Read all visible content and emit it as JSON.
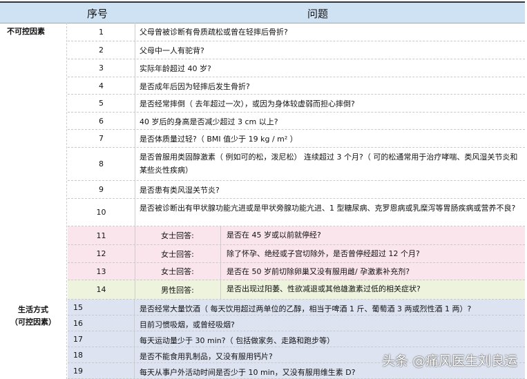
{
  "header": {
    "col_num": "序号",
    "col_q": "问题"
  },
  "categories": {
    "uncontrollable": "不可控因素",
    "lifestyle_1": "生活方式",
    "lifestyle_2": "（可控因素）"
  },
  "rows": [
    {
      "n": "1",
      "q": "父母曾被诊断有骨质疏松或曾在轻摔后骨折?"
    },
    {
      "n": "2",
      "q": "父母中一人有驼背?"
    },
    {
      "n": "3",
      "q": "实际年龄超过 40 岁?"
    },
    {
      "n": "4",
      "q": "是否成年后因为轻摔后发生骨折?"
    },
    {
      "n": "5",
      "q": "是否经常摔倒（ 去年超过一次），或因为身体较虚弱而担心摔倒?"
    },
    {
      "n": "6",
      "q": "40 岁后的身高是否减少超过 3 cm 以上?"
    },
    {
      "n": "7",
      "q": "是否体质量过轻?（ BMI 值少于 19 kg / m² ）"
    },
    {
      "n": "8",
      "q": "是否曾服用类固醇激素（ 例如可的松，泼尼松） 连续超过 3 个月?（ 可的松通常用于治疗哮喘、类风湿关节炎和某些炎性疾病）"
    },
    {
      "n": "9",
      "q": "是否患有类风湿关节炎?"
    },
    {
      "n": "10",
      "q": "是否被诊断出有甲状腺功能亢进或是甲状旁腺功能亢进、1 型糖尿病、克罗恩病或乳糜泻等胃肠疾病或营养不良?"
    },
    {
      "n": "11",
      "label": "女士回答:",
      "q": "是否在 45 岁或以前就停经?"
    },
    {
      "n": "12",
      "label": "女士回答:",
      "q": "除了怀孕、绝经或子宫切除外，是否曾停经超过 12 个月?"
    },
    {
      "n": "13",
      "label": "女士回答:",
      "q": "是否在 50 岁前切除卵巢又没有服用雌/ 孕激素补充剂?"
    },
    {
      "n": "14",
      "label": "男性回答:",
      "q": "是否出现过阳萎、性欲减退或其他雄激素过低的相关症状?"
    },
    {
      "n": "15",
      "q": "是否经常大量饮酒（ 每天饮用超过两单位的乙醇，相当于啤酒 1 斤、葡萄酒 3 两或烈性酒 1 两）?"
    },
    {
      "n": "16",
      "q": "目前习惯吸烟，或曾经吸烟?"
    },
    {
      "n": "17",
      "q": "每天运动量少于 30 min?（ 包括做家务、走路和跑步等）"
    },
    {
      "n": "18",
      "q": "是否不能食用乳制品，又没有服用钙片?"
    },
    {
      "n": "19",
      "q": "每天从事户外活动时间是否少于 10 min，又没有服用维生素 D?"
    }
  ],
  "watermark": "头条 @痛风医生刘良运",
  "colors": {
    "header": "#cfe2f4",
    "female": "#fbe5ec",
    "male": "#eef3de",
    "lifestyle": "#dde3f1"
  }
}
